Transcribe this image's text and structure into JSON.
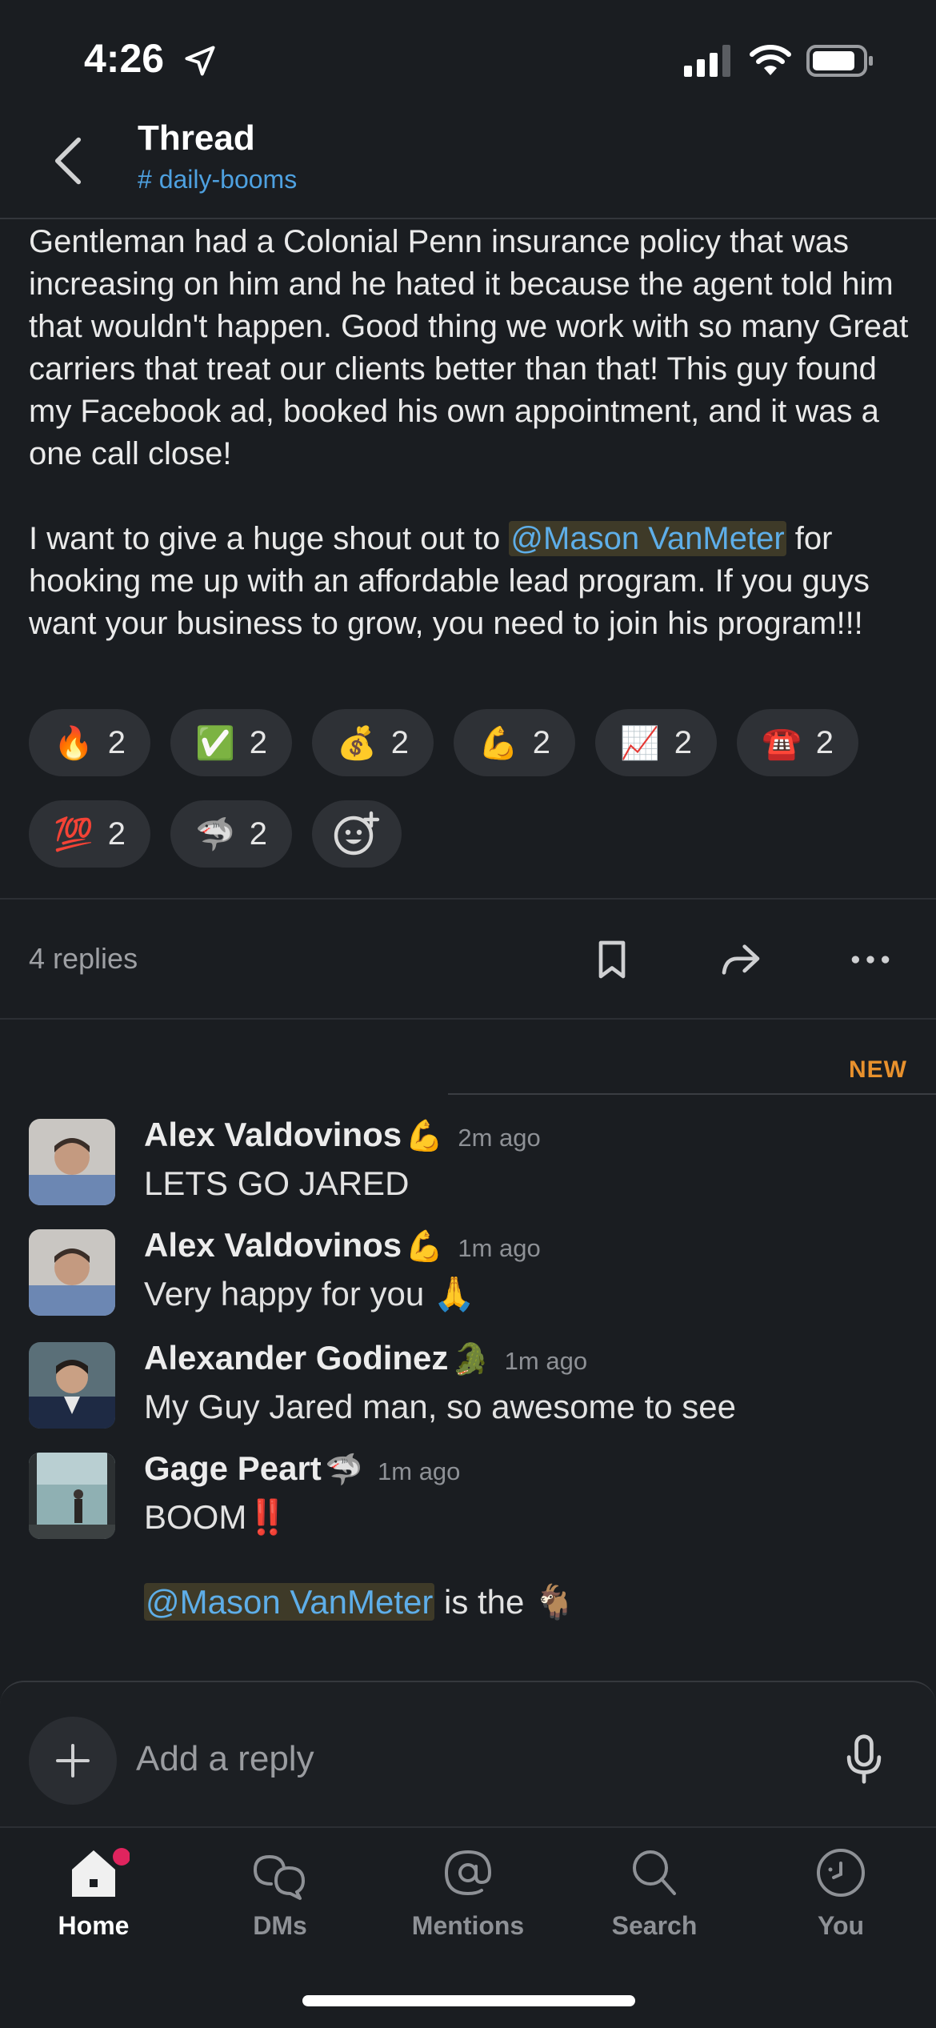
{
  "status_bar": {
    "time": "4:26"
  },
  "header": {
    "title": "Thread",
    "channel": "daily-booms",
    "channel_prefix": "#"
  },
  "message": {
    "paragraph1": "Gentleman had a Colonial Penn insurance policy that was increasing on him and he hated it because the agent told him that wouldn't happen. Good thing we work with so many Great carriers that treat our clients better than that! This guy found my Facebook ad, booked his own appointment, and it was a one call close!",
    "paragraph2_before": "I want to give a huge shout out to ",
    "paragraph2_mention": "@Mason VanMeter",
    "paragraph2_after": " for hooking me up with an affordable lead program. If you guys want your business to grow, you need to join his program!!!"
  },
  "reactions": [
    {
      "emoji": "🔥",
      "count": "2"
    },
    {
      "emoji": "✅",
      "count": "2"
    },
    {
      "emoji": "💰",
      "count": "2"
    },
    {
      "emoji": "💪",
      "count": "2"
    },
    {
      "emoji": "📈",
      "count": "2"
    },
    {
      "emoji": "☎️",
      "count": "2"
    },
    {
      "emoji": "💯",
      "count": "2"
    },
    {
      "emoji": "🦈",
      "count": "2"
    }
  ],
  "thread_actions": {
    "replies_label": "4 replies"
  },
  "new_label": "NEW",
  "replies": [
    {
      "author": "Alex Valdovinos",
      "status_emoji": "💪",
      "time": "2m ago",
      "text": "LETS GO JARED",
      "avatar_bg": "#7b8fa8"
    },
    {
      "author": "Alex Valdovinos",
      "status_emoji": "💪",
      "time": "1m ago",
      "text": "Very happy for you 🙏",
      "avatar_bg": "#7b8fa8"
    },
    {
      "author": "Alexander Godinez",
      "status_emoji": "🐊",
      "time": "1m ago",
      "text": "My Guy Jared man, so awesome to see",
      "avatar_bg": "#2e3a4e"
    },
    {
      "author": "Gage Peart",
      "status_emoji": "🦈",
      "time": "1m ago",
      "text": "BOOM‼️",
      "avatar_bg": "#6f8a8c"
    }
  ],
  "last_reply_extra": {
    "mention": "@Mason VanMeter",
    "after": " is the 🐐"
  },
  "composer": {
    "placeholder": "Add a reply"
  },
  "tabs": [
    {
      "label": "Home",
      "active": true
    },
    {
      "label": "DMs",
      "active": false
    },
    {
      "label": "Mentions",
      "active": false
    },
    {
      "label": "Search",
      "active": false
    },
    {
      "label": "You",
      "active": false
    }
  ],
  "colors": {
    "background": "#1a1d21",
    "link": "#4ea1e0",
    "new": "#e8912d",
    "badge": "#e0245e"
  }
}
